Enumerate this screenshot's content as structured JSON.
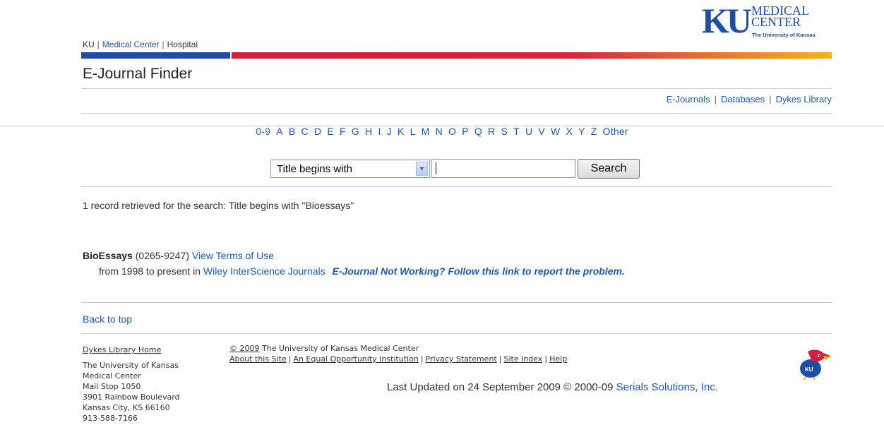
{
  "header": {
    "top_links": [
      "KU",
      "Medical Center",
      "Hospital"
    ],
    "logo": {
      "ku": "KU",
      "line1": "MEDICAL",
      "line2": "CENTER",
      "line3": "The University of Kansas"
    },
    "page_title": "E-Journal Finder",
    "nav_links": [
      "E-Journals",
      "Databases",
      "Dykes Library"
    ],
    "colors": {
      "blue": "#1f4fa5",
      "red": "#d31f3a",
      "gold": "#f3b41b",
      "link": "#1a5ab4"
    }
  },
  "alpha_nav": [
    "0-9",
    "A",
    "B",
    "C",
    "D",
    "E",
    "F",
    "G",
    "H",
    "I",
    "J",
    "K",
    "L",
    "M",
    "N",
    "O",
    "P",
    "Q",
    "R",
    "S",
    "T",
    "U",
    "V",
    "W",
    "X",
    "Y",
    "Z",
    "Other"
  ],
  "search": {
    "type_selected": "Title begins with",
    "input_value": "",
    "button_label": "Search"
  },
  "results": {
    "summary": "1 record retrieved for the search: Title begins with \"Bioessays\"",
    "record": {
      "title": "BioEssays",
      "issn": "(0265-9247)",
      "terms_link": "View Terms of Use",
      "coverage": "from 1998 to present in",
      "provider_link": "Wiley InterScience Journals",
      "report_link": "E-Journal Not Working? Follow this link to report the problem."
    }
  },
  "back_to_top": "Back to top",
  "footer": {
    "home_link": "Dykes Library Home",
    "address": [
      "The University of Kansas",
      "Medical Center",
      "Mail Stop 1050",
      "3901 Rainbow Boulevard",
      "Kansas City, KS 66160",
      "913-588-7166"
    ],
    "copyright_link": "© 2009",
    "copyright_text": " The University of Kansas Medical Center",
    "links": [
      "About this Site",
      "An Equal Opportunity Institution",
      "Privacy Statement",
      "Site Index",
      "Help"
    ],
    "updated_text": "Last Updated on 24 September 2009 © 2000-09",
    "serials_link": "Serials Solutions, Inc."
  }
}
